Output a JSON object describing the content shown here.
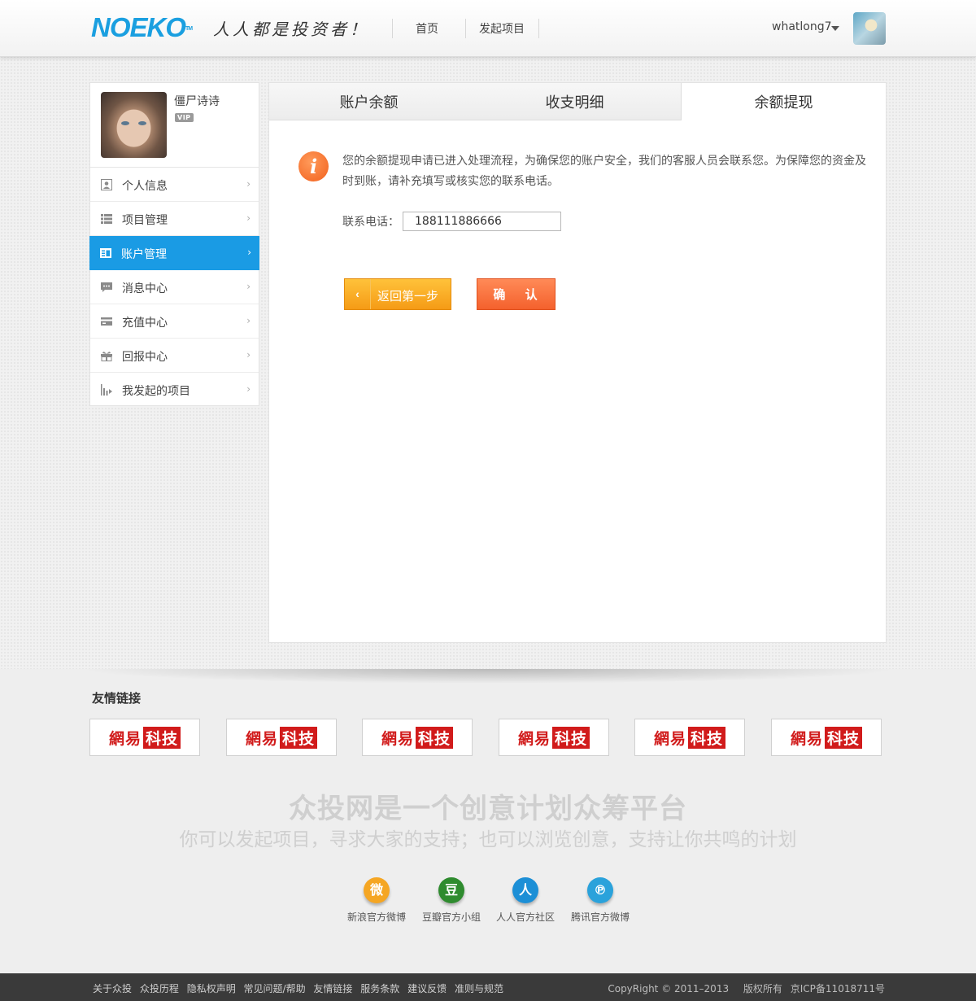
{
  "header": {
    "logo": "NOEKO",
    "logo_tm": "TM",
    "slogan": "人人都是投资者！",
    "nav": [
      "首页",
      "发起项目"
    ],
    "username": "whatlong7"
  },
  "sidebar": {
    "profile_name": "僵尸诗诗",
    "vip_label": "VIP",
    "items": [
      {
        "label": "个人信息",
        "icon": "user-card-icon"
      },
      {
        "label": "项目管理",
        "icon": "list-icon"
      },
      {
        "label": "账户管理",
        "icon": "account-icon",
        "active": true
      },
      {
        "label": "消息中心",
        "icon": "message-icon"
      },
      {
        "label": "充值中心",
        "icon": "card-icon"
      },
      {
        "label": "回报中心",
        "icon": "gift-icon"
      },
      {
        "label": "我发起的项目",
        "icon": "chart-icon"
      }
    ]
  },
  "tabs": [
    "账户余额",
    "收支明细",
    "余额提现"
  ],
  "active_tab": 2,
  "notice": "您的余额提现申请已进入处理流程，为确保您的账户安全，我们的客服人员会联系您。为保障您的资金及时到账，请补充填写或核实您的联系电话。",
  "phone": {
    "label": "联系电话：",
    "value": "188111886666"
  },
  "buttons": {
    "back": "返回第一步",
    "confirm": "确 认"
  },
  "footer": {
    "friend_links_title": "友情链接",
    "partner": {
      "part1": "網易",
      "part2": "科技"
    },
    "partner_count": 6,
    "slogan_main": "众投网是一个创意计划众筹平台",
    "slogan_sub": "你可以发起项目，寻求大家的支持；也可以浏览创意，支持让你共鸣的计划",
    "social": [
      {
        "label": "新浪官方微博",
        "icon": "weibo-icon",
        "glyph": "微",
        "color": "#f5a623"
      },
      {
        "label": "豆瓣官方小组",
        "icon": "douban-icon",
        "glyph": "豆",
        "color": "#2e8b2e"
      },
      {
        "label": "人人官方社区",
        "icon": "renren-icon",
        "glyph": "人",
        "color": "#1c8fd6"
      },
      {
        "label": "腾讯官方微博",
        "icon": "tencent-weibo-icon",
        "glyph": "℗",
        "color": "#2aa2db"
      }
    ],
    "bottom_links": [
      "关于众投",
      "众投历程",
      "隐私权声明",
      "常见问题/帮助",
      "友情链接",
      "服务条款",
      "建议反馈",
      "准则与规范"
    ],
    "copyright": "CopyRight © 2011–2013",
    "rights": "版权所有",
    "icp": "京ICP备11018711号"
  }
}
